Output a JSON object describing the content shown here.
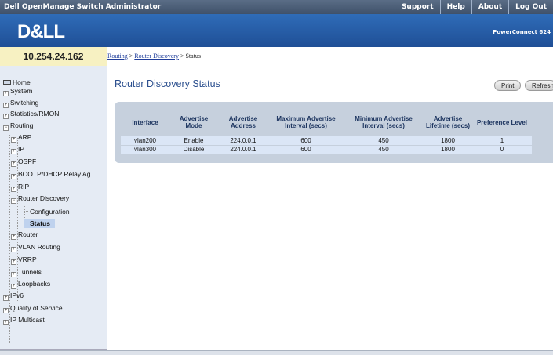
{
  "app_title": "Dell OpenManage Switch Administrator",
  "top_links": [
    "Support",
    "Help",
    "About",
    "Log Out"
  ],
  "logo_text": "D&LL",
  "product_name": "PowerConnect 624",
  "ip_address": "10.254.24.162",
  "breadcrumb": {
    "items": [
      "Routing",
      "Router Discovery",
      "Status"
    ],
    "separator": " > "
  },
  "sidebar": {
    "items": [
      {
        "label": "Home",
        "icon": "home-icon"
      },
      {
        "label": "System",
        "icon": "expand-icon"
      },
      {
        "label": "Switching",
        "icon": "expand-icon"
      },
      {
        "label": "Statistics/RMON",
        "icon": "expand-icon"
      },
      {
        "label": "Routing",
        "icon": "collapse-icon"
      },
      {
        "label": "ARP",
        "icon": "expand-icon"
      },
      {
        "label": "IP",
        "icon": "expand-icon"
      },
      {
        "label": "OSPF",
        "icon": "expand-icon"
      },
      {
        "label": "BOOTP/DHCP Relay Ag",
        "icon": "expand-icon"
      },
      {
        "label": "RIP",
        "icon": "expand-icon"
      },
      {
        "label": "Router Discovery",
        "icon": "collapse-icon"
      },
      {
        "label": "Configuration",
        "icon": ""
      },
      {
        "label": "Status",
        "icon": ""
      },
      {
        "label": "Router",
        "icon": "expand-icon"
      },
      {
        "label": "VLAN Routing",
        "icon": "expand-icon"
      },
      {
        "label": "VRRP",
        "icon": "expand-icon"
      },
      {
        "label": "Tunnels",
        "icon": "expand-icon"
      },
      {
        "label": "Loopbacks",
        "icon": "expand-icon"
      },
      {
        "label": "IPv6",
        "icon": "expand-icon"
      },
      {
        "label": "Quality of Service",
        "icon": "expand-icon"
      },
      {
        "label": "IP Multicast",
        "icon": "expand-icon"
      }
    ],
    "selected": "Status"
  },
  "main": {
    "title": "Router Discovery Status",
    "print_label": "Print",
    "refresh_label": "Refresh",
    "table": {
      "headers": [
        "Interface",
        "Advertise Mode",
        "Advertise Address",
        "Maximum Advertise Interval (secs)",
        "Minimum Advertise Interval (secs)",
        "Advertise Lifetime (secs)",
        "Preference Level"
      ],
      "rows": [
        [
          "vlan200",
          "Enable",
          "224.0.0.1",
          "600",
          "450",
          "1800",
          "1"
        ],
        [
          "vlan300",
          "Disable",
          "224.0.0.1",
          "600",
          "450",
          "1800",
          "0"
        ]
      ]
    }
  },
  "colors": {
    "topbar": "#4a5d78",
    "banner": "#2a62ad",
    "ip_box": "#f7f1c2",
    "sidebar": "#e5ebf4",
    "selected": "#bfd2ee",
    "title": "#2b4f8e",
    "table_frame": "#c6d0dd",
    "table_row": "#dbe6f6"
  }
}
